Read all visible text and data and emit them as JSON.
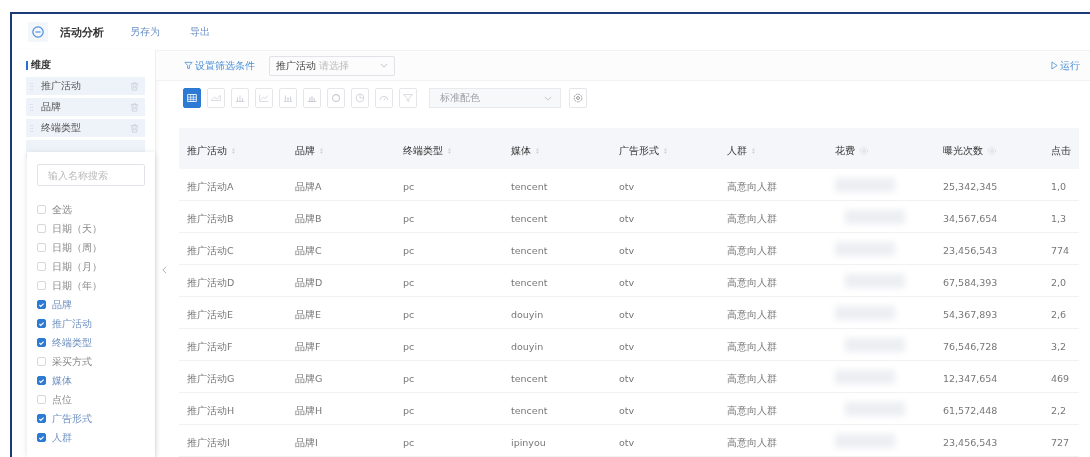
{
  "header": {
    "title": "活动分析",
    "actions": [
      "另存为",
      "导出"
    ]
  },
  "sidebar": {
    "heading": "维度",
    "items": [
      {
        "label": "推广活动"
      },
      {
        "label": "品牌"
      },
      {
        "label": "终端类型"
      }
    ]
  },
  "field_popup": {
    "search": {
      "placeholder": "输入名称搜索"
    },
    "options": [
      {
        "label": "全选",
        "checked": false
      },
      {
        "label": "日期（天）",
        "checked": false
      },
      {
        "label": "日期（周）",
        "checked": false
      },
      {
        "label": "日期（月）",
        "checked": false
      },
      {
        "label": "日期（年）",
        "checked": false
      },
      {
        "label": "品牌",
        "checked": true
      },
      {
        "label": "推广活动",
        "checked": true
      },
      {
        "label": "终端类型",
        "checked": true
      },
      {
        "label": "采买方式",
        "checked": false
      },
      {
        "label": "媒体",
        "checked": true
      },
      {
        "label": "点位",
        "checked": false
      },
      {
        "label": "广告形式",
        "checked": true
      },
      {
        "label": "人群",
        "checked": true
      }
    ]
  },
  "filter_bar": {
    "filter_button": "设置筛选条件",
    "select": {
      "label": "推广活动",
      "placeholder": "请选择"
    },
    "run_button": "运行"
  },
  "chart_toolbar": {
    "chart_types": [
      {
        "kind": "table",
        "selected": true
      },
      {
        "kind": "area",
        "selected": false
      },
      {
        "kind": "bar",
        "selected": false
      },
      {
        "kind": "line",
        "selected": false
      },
      {
        "kind": "stacked",
        "selected": false
      },
      {
        "kind": "column",
        "selected": false
      },
      {
        "kind": "ring",
        "selected": false
      },
      {
        "kind": "pie",
        "selected": false
      },
      {
        "kind": "gauge",
        "selected": false
      },
      {
        "kind": "funnel",
        "selected": false
      }
    ],
    "color_select": {
      "placeholder": "标准配色"
    }
  },
  "table": {
    "columns": [
      {
        "label": "推广活动",
        "kind": "sort"
      },
      {
        "label": "品牌",
        "kind": "sort"
      },
      {
        "label": "终端类型",
        "kind": "sort"
      },
      {
        "label": "媒体",
        "kind": "sort"
      },
      {
        "label": "广告形式",
        "kind": "sort"
      },
      {
        "label": "人群",
        "kind": "sort"
      },
      {
        "label": "花费",
        "kind": "gear"
      },
      {
        "label": "曝光次数",
        "kind": "gear"
      },
      {
        "label": "点击",
        "kind": "plain"
      }
    ],
    "rows": [
      [
        "推广活动A",
        "品牌A",
        "pc",
        "tencent",
        "otv",
        "高意向人群",
        null,
        "25,342,345",
        "1,0"
      ],
      [
        "推广活动B",
        "品牌B",
        "pc",
        "tencent",
        "otv",
        "高意向人群",
        null,
        "34,567,654",
        "1,3"
      ],
      [
        "推广活动C",
        "品牌C",
        "pc",
        "tencent",
        "otv",
        "高意向人群",
        null,
        "23,456,543",
        "774"
      ],
      [
        "推广活动D",
        "品牌D",
        "pc",
        "tencent",
        "otv",
        "高意向人群",
        null,
        "67,584,393",
        "2,0"
      ],
      [
        "推广活动E",
        "品牌E",
        "pc",
        "douyin",
        "otv",
        "高意向人群",
        null,
        "54,367,893",
        "2,6"
      ],
      [
        "推广活动F",
        "品牌F",
        "pc",
        "douyin",
        "otv",
        "高意向人群",
        null,
        "76,546,728",
        "3,2"
      ],
      [
        "推广活动G",
        "品牌G",
        "pc",
        "tencent",
        "otv",
        "高意向人群",
        null,
        "12,347,654",
        "469"
      ],
      [
        "推广活动H",
        "品牌H",
        "pc",
        "tencent",
        "otv",
        "高意向人群",
        null,
        "61,572,448",
        "2,2"
      ],
      [
        "推广活动I",
        "品牌I",
        "pc",
        "ipinyou",
        "otv",
        "高意向人群",
        null,
        "23,456,543",
        "727"
      ]
    ]
  }
}
